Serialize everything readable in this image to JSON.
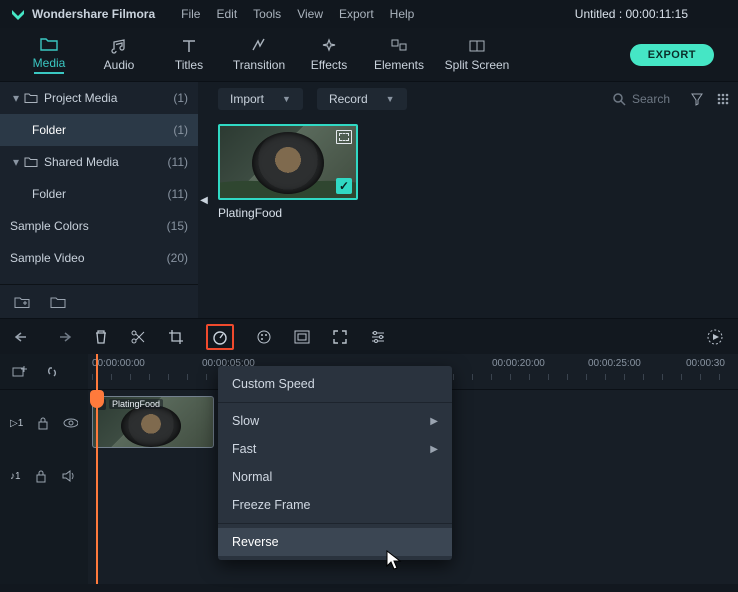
{
  "title_bar": {
    "app_name": "Wondershare Filmora",
    "menus": [
      "File",
      "Edit",
      "Tools",
      "View",
      "Export",
      "Help"
    ],
    "document": "Untitled : 00:00:11:15"
  },
  "main_tabs": {
    "items": [
      {
        "label": "Media",
        "icon": "folder-icon"
      },
      {
        "label": "Audio",
        "icon": "music-icon"
      },
      {
        "label": "Titles",
        "icon": "text-icon"
      },
      {
        "label": "Transition",
        "icon": "transition-icon"
      },
      {
        "label": "Effects",
        "icon": "sparkle-icon"
      },
      {
        "label": "Elements",
        "icon": "elements-icon"
      },
      {
        "label": "Split Screen",
        "icon": "splitscreen-icon"
      }
    ],
    "active_index": 0,
    "export_label": "EXPORT"
  },
  "sidebar": {
    "items": [
      {
        "label": "Project Media",
        "count": "(1)",
        "level": 0,
        "expandable": true
      },
      {
        "label": "Folder",
        "count": "(1)",
        "level": 1,
        "selected": true
      },
      {
        "label": "Shared Media",
        "count": "(11)",
        "level": 0,
        "expandable": true
      },
      {
        "label": "Folder",
        "count": "(11)",
        "level": 1
      },
      {
        "label": "Sample Colors",
        "count": "(15)",
        "level": -1
      },
      {
        "label": "Sample Video",
        "count": "(20)",
        "level": -1
      }
    ]
  },
  "content_bar": {
    "import_label": "Import",
    "record_label": "Record",
    "search_placeholder": "Search"
  },
  "clip": {
    "name": "PlatingFood"
  },
  "timeline": {
    "ticks": [
      "00:00:00:00",
      "00:00:05:00",
      "00:00:20:00",
      "00:00:25:00",
      "00:00:30"
    ],
    "tracks": {
      "video_label": "▷1",
      "audio_label": "♪1"
    },
    "clip_label": "PlatingFood"
  },
  "context_menu": {
    "items": [
      {
        "label": "Custom Speed",
        "sep_after": true
      },
      {
        "label": "Slow",
        "submenu": true
      },
      {
        "label": "Fast",
        "submenu": true
      },
      {
        "label": "Normal"
      },
      {
        "label": "Freeze Frame",
        "sep_after": true
      },
      {
        "label": "Reverse",
        "highlight": true
      }
    ]
  }
}
